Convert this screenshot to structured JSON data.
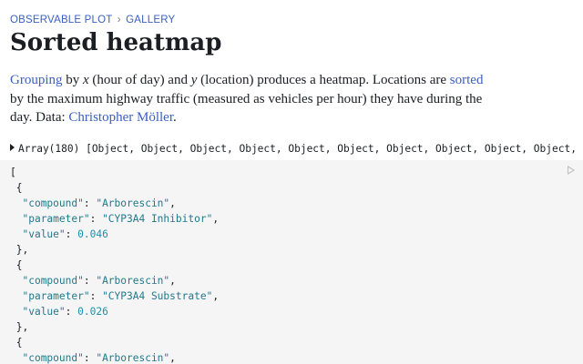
{
  "breadcrumb": {
    "part1": "OBSERVABLE PLOT",
    "separator": "›",
    "part2": "GALLERY"
  },
  "title": "Sorted heatmap",
  "description": {
    "link1": "Grouping",
    "t1": " by ",
    "x": "x",
    "t2": " (hour of day) and ",
    "y": "y",
    "t3": " (location) produces a heatmap. Locations are ",
    "link2": "sorted",
    "t4": " by the maximum highway traffic (measured as vehicles per hour) they have during the day. Data: ",
    "link3": "Christopher Möller",
    "t5": "."
  },
  "summary": "Array(180) [Object, Object, Object, Object, Object, Object, Object, Object, Object, Object, Obj",
  "json_view": {
    "open_bracket": "[",
    "records": [
      {
        "compound": "Arborescin",
        "parameter": "CYP3A4 Inhibitor",
        "value": "0.046"
      },
      {
        "compound": "Arborescin",
        "parameter": "CYP3A4 Substrate",
        "value": "0.026"
      },
      {
        "compound": "Arborescin"
      }
    ],
    "keys": {
      "compound": "\"compound\"",
      "parameter": "\"parameter\"",
      "value": "\"value\""
    }
  },
  "colors": {
    "link": "#3b5fc0",
    "code_bg": "#f5f5f5",
    "string": "#1f7a8c"
  },
  "icons": {
    "run": "play-icon",
    "expand": "disclosure-triangle-icon"
  }
}
